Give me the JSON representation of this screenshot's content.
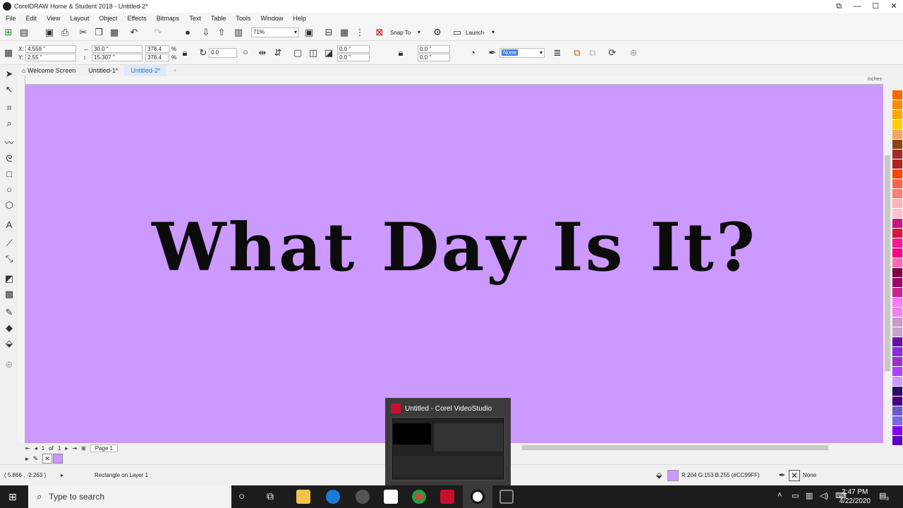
{
  "window": {
    "title": "CorelDRAW Home & Student 2018 - Untitled-2*"
  },
  "menu": [
    "File",
    "Edit",
    "View",
    "Layout",
    "Object",
    "Effects",
    "Bitmaps",
    "Text",
    "Table",
    "Tools",
    "Window",
    "Help"
  ],
  "standard_toolbar": {
    "zoom": "71%",
    "snap_to": "Snap To",
    "launch": "Launch"
  },
  "property_bar": {
    "x": "4.559 \"",
    "y": "2.55 \"",
    "width": "30.0 \"",
    "height": "15.307 \"",
    "scale_x": "378.4",
    "scale_y": "378.4",
    "percent": "%",
    "rotation": "0.0",
    "corner_tl": "0.0 \"",
    "corner_bl": "0.0 \"",
    "corner_tr": "0.0 \"",
    "corner_br": "0.0 \"",
    "outline": "None"
  },
  "tabs": [
    {
      "label": "Welcome Screen"
    },
    {
      "label": "Untitled-1*"
    },
    {
      "label": "Untitled-2*"
    }
  ],
  "ruler": {
    "units": "inches"
  },
  "canvas": {
    "background": "#cc99ff",
    "headline": "What Day Is It?"
  },
  "page_nav": {
    "current": "1",
    "of": "of",
    "total": "1",
    "page_tab": "Page 1"
  },
  "status": {
    "coords": "( 5.866 , -2.263 )",
    "selection": "Rectangle on Layer 1",
    "fill_info": "R:204 G:153 B:255 (#CC99FF)",
    "outline_info": "None"
  },
  "preview": {
    "title": "Untitled - Corel VideoStudio"
  },
  "taskbar": {
    "search_placeholder": "Type to search",
    "time": "2:47 PM",
    "date": "4/22/2020",
    "notif_count": "3"
  },
  "palette_colors": [
    "#ff6600",
    "#ff8c00",
    "#ffa500",
    "#ffcc00",
    "#f4a460",
    "#8b4513",
    "#a52a2a",
    "#b22222",
    "#ff4500",
    "#ff6347",
    "#fa8072",
    "#ffb6b6",
    "#ffc0cb",
    "#c71585",
    "#dc143c",
    "#ff1493",
    "#ff007f",
    "#ff69b4",
    "#800040",
    "#a0006a",
    "#d02090",
    "#ff77ff",
    "#ee82ee",
    "#cc99cc",
    "#c8a2c8",
    "#6a0dad",
    "#8a2be2",
    "#9932cc",
    "#b040ff",
    "#cc99ff",
    "#2e0a6e",
    "#4b0082",
    "#6a5acd",
    "#7b68ee",
    "#8000ff",
    "#5a00c8"
  ]
}
